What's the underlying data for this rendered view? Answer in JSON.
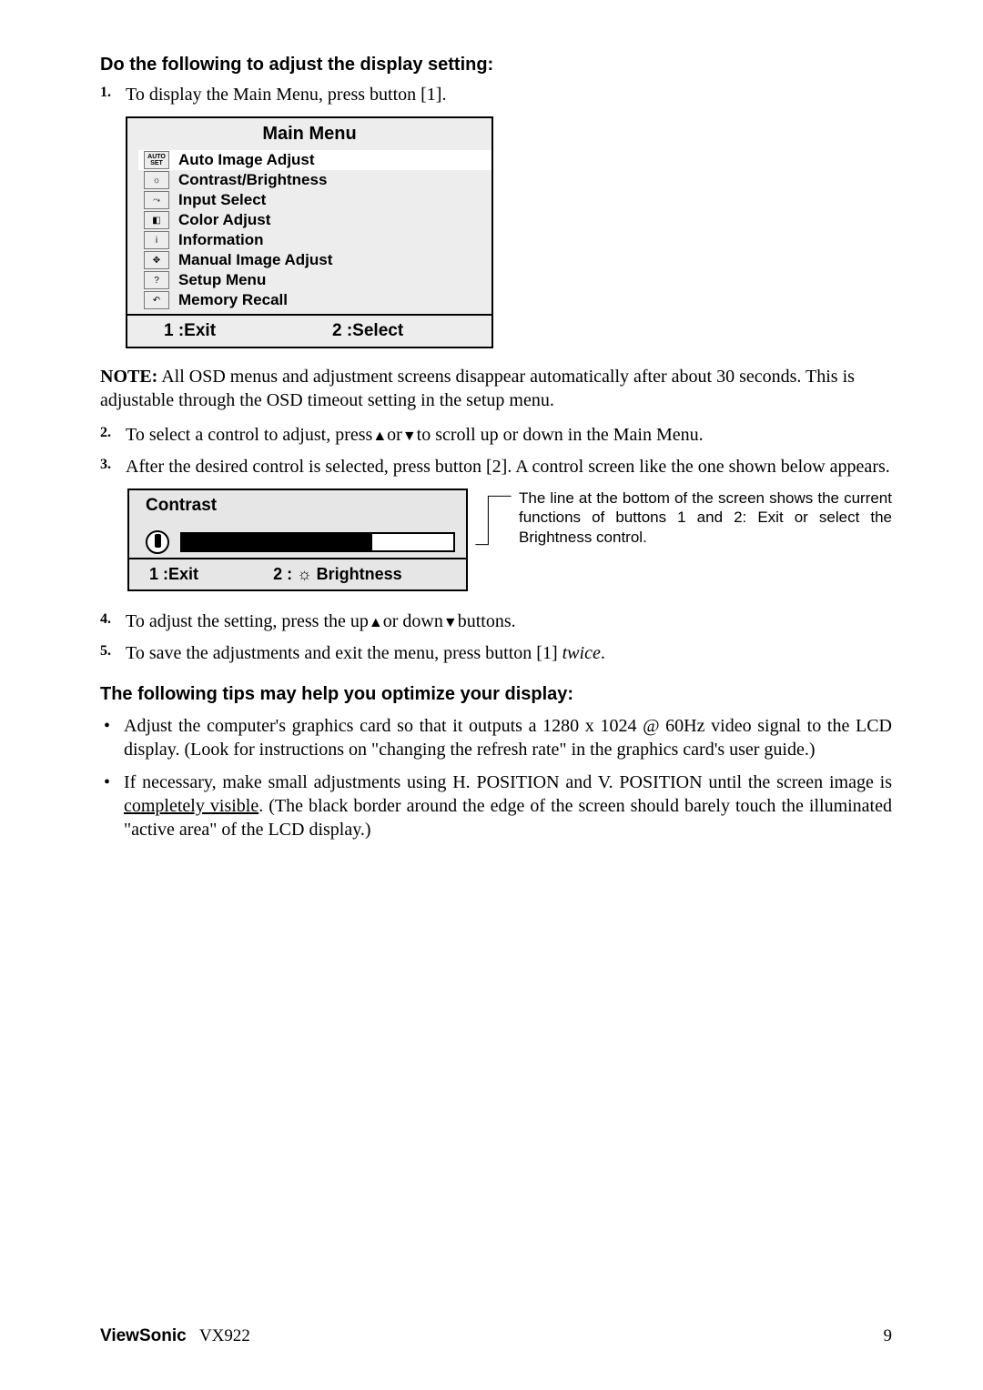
{
  "heading1": "Do the following to adjust the display setting:",
  "step1": {
    "num": "1.",
    "text": "To display the Main Menu, press button [1]."
  },
  "menu": {
    "title": "Main Menu",
    "items": [
      {
        "icon": "AUTO SET",
        "label": "Auto Image Adjust",
        "highlight": true
      },
      {
        "icon": "☼",
        "label": "Contrast/Brightness"
      },
      {
        "icon": "⤳",
        "label": "Input Select"
      },
      {
        "icon": "◧",
        "label": "Color Adjust"
      },
      {
        "icon": "i",
        "label": "Information"
      },
      {
        "icon": "✥",
        "label": "Manual Image Adjust"
      },
      {
        "icon": "?",
        "label": "Setup Menu"
      },
      {
        "icon": "↶",
        "label": "Memory Recall"
      }
    ],
    "footer_left": "1 :Exit",
    "footer_right": "2 :Select"
  },
  "note_label": "NOTE:",
  "note_text": " All OSD menus and adjustment screens disappear automatically after about 30 seconds. This is adjustable through the OSD timeout setting in the setup menu.",
  "step2": {
    "num": "2.",
    "pre": "To select a control to adjust, press",
    "mid": "or",
    "post": "to scroll up or down in the Main Menu."
  },
  "step3": {
    "num": "3.",
    "text": "After the desired control is selected, press button [2]. A control screen like the one shown below appears."
  },
  "contrast": {
    "title": "Contrast",
    "footer_left": "1 :Exit",
    "footer_right": "2 : ☼ Brightness"
  },
  "callout": "The line at the bottom of the screen shows the current functions of buttons 1 and 2: Exit or select the Brightness control.",
  "step4": {
    "num": "4.",
    "pre": "To adjust the setting, press the up",
    "mid": "or down",
    "post": "buttons."
  },
  "step5": {
    "num": "5.",
    "pre": "To save the adjustments and exit the menu, press button [1] ",
    "italic": "twice",
    "post": "."
  },
  "heading2": "The following tips may help you optimize your display:",
  "tip1": "Adjust the computer's graphics card so that it outputs a 1280 x 1024 @ 60Hz video signal to the LCD display. (Look for instructions on \"changing the refresh rate\" in the graphics card's user guide.)",
  "tip2_pre": "If necessary, make small adjustments using H. POSITION and V. POSITION until the screen image is ",
  "tip2_underline": "completely visible",
  "tip2_post": ". (The black border around the edge of the screen should barely touch the illuminated \"active area\" of the LCD display.)",
  "footer_brand_bold": "ViewSonic",
  "footer_brand_model": "VX922",
  "footer_page": "9"
}
